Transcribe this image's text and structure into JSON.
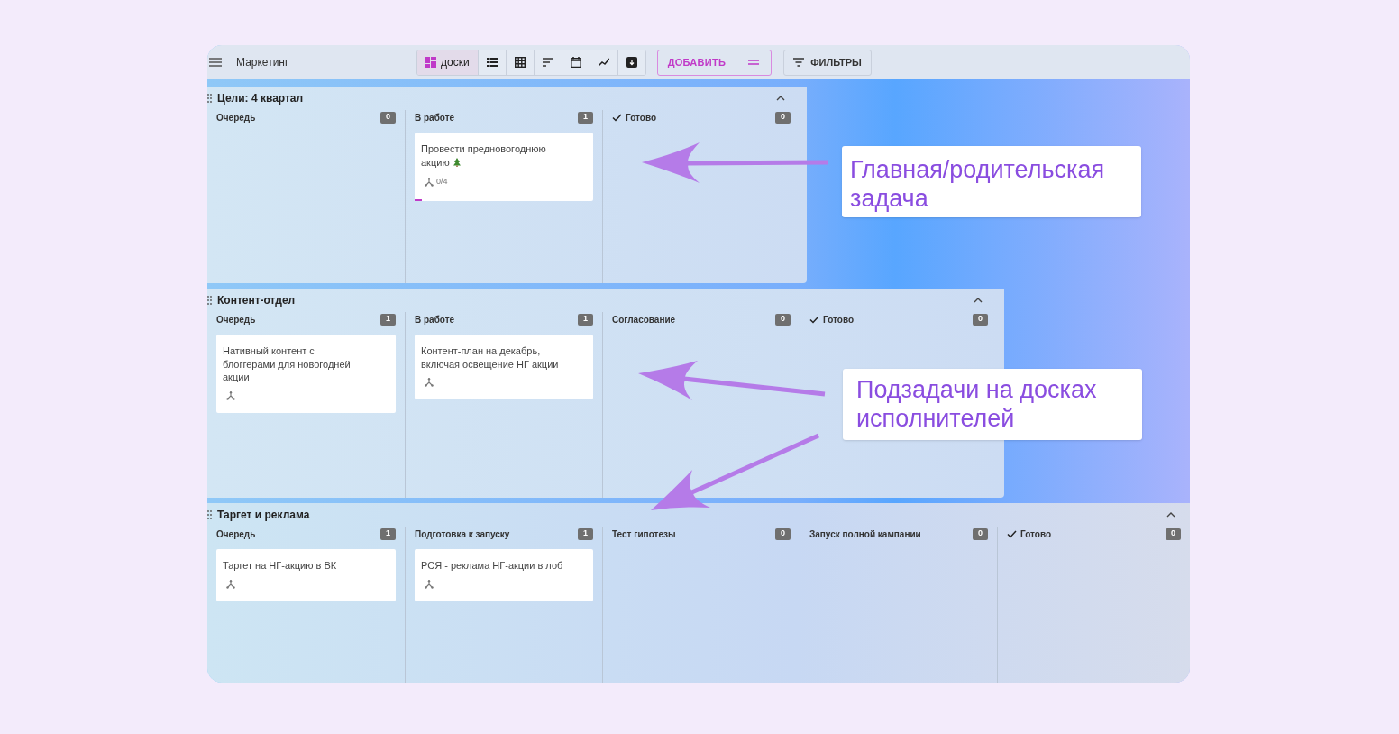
{
  "app": {
    "title": "Маркетинг"
  },
  "views": [
    {
      "kind": "boards",
      "label": "доски",
      "selected": true
    },
    {
      "kind": "list",
      "selected": false
    },
    {
      "kind": "table",
      "selected": false
    },
    {
      "kind": "sort",
      "selected": false
    },
    {
      "kind": "calendar",
      "selected": false
    },
    {
      "kind": "chart",
      "selected": false
    },
    {
      "kind": "archive",
      "selected": false
    }
  ],
  "add_button": {
    "label": "ДОБАВИТЬ"
  },
  "filters_button": {
    "label": "ФИЛЬТРЫ"
  },
  "boards": [
    {
      "title": "Цели: 4 квартал",
      "expanded": true,
      "columns": [
        {
          "title": "Очередь",
          "count": "0",
          "done": false
        },
        {
          "title": "В работе",
          "count": "1",
          "done": false,
          "cards": [
            {
              "text": "Провести предновогоднюю акцию",
              "tree_icon": true,
              "subtasks": "0/4",
              "progress_marker": true
            }
          ]
        },
        {
          "title": "Готово",
          "count": "0",
          "done": true
        }
      ]
    },
    {
      "title": "Контент-отдел",
      "expanded": true,
      "columns": [
        {
          "title": "Очередь",
          "count": "1",
          "done": false,
          "cards": [
            {
              "text": "Нативный контент с блоггерами для новогодней акции",
              "tree_icon": false,
              "progress_marker": false
            }
          ]
        },
        {
          "title": "В работе",
          "count": "1",
          "done": false,
          "cards": [
            {
              "text": "Контент-план на декабрь, включая освещение НГ акции",
              "tree_icon": false,
              "progress_marker": false
            }
          ]
        },
        {
          "title": "Согласование",
          "count": "0",
          "done": false
        },
        {
          "title": "Готово",
          "count": "0",
          "done": true
        }
      ]
    },
    {
      "title": "Таргет и реклама",
      "expanded": true,
      "columns": [
        {
          "title": "Очередь",
          "count": "1",
          "done": false,
          "cards": [
            {
              "text": "Таргет на НГ-акцию в ВК",
              "tree_icon": false,
              "progress_marker": false
            }
          ]
        },
        {
          "title": "Подготовка к запуску",
          "count": "1",
          "done": false,
          "cards": [
            {
              "text": "РСЯ - реклама НГ-акции в лоб",
              "tree_icon": false,
              "progress_marker": false
            }
          ]
        },
        {
          "title": "Тест гипотезы",
          "count": "0",
          "done": false
        },
        {
          "title": "Запуск полной кампании",
          "count": "0",
          "done": false
        },
        {
          "title": "Готово",
          "count": "0",
          "done": true
        }
      ]
    }
  ],
  "callouts": [
    {
      "text": "Главная/родительская задача"
    },
    {
      "text": "Подзадачи на досках исполнителей"
    }
  ]
}
